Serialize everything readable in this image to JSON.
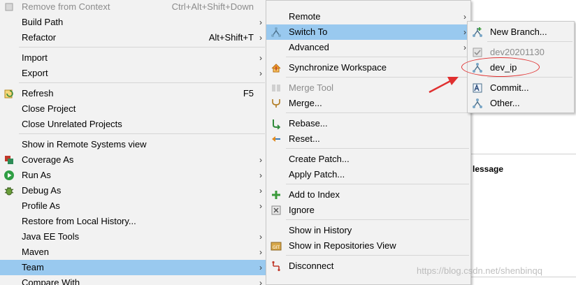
{
  "background": {
    "header": "lessage"
  },
  "context_menu": {
    "items": [
      {
        "label": "Remove from Context",
        "accel": "Ctrl+Alt+Shift+Down",
        "disabled": true,
        "icon": "remove-context-icon"
      },
      {
        "label": "Build Path",
        "submenu": true
      },
      {
        "label": "Refactor",
        "accel": "Alt+Shift+T",
        "submenu": true
      },
      {
        "label": "Import",
        "submenu": true
      },
      {
        "label": "Export",
        "submenu": true
      },
      {
        "label": "Refresh",
        "accel": "F5",
        "icon": "refresh-icon"
      },
      {
        "label": "Close Project"
      },
      {
        "label": "Close Unrelated Projects"
      },
      {
        "label": "Show in Remote Systems view"
      },
      {
        "label": "Coverage As",
        "submenu": true,
        "icon": "coverage-icon"
      },
      {
        "label": "Run As",
        "submenu": true,
        "icon": "run-icon"
      },
      {
        "label": "Debug As",
        "submenu": true,
        "icon": "debug-icon"
      },
      {
        "label": "Profile As",
        "submenu": true
      },
      {
        "label": "Restore from Local History..."
      },
      {
        "label": "Java EE Tools",
        "submenu": true
      },
      {
        "label": "Maven",
        "submenu": true
      },
      {
        "label": "Team",
        "submenu": true,
        "selected": true
      },
      {
        "label": "Compare With",
        "submenu": true
      }
    ]
  },
  "team_menu": {
    "items": [
      {
        "label": "Remote",
        "submenu": true
      },
      {
        "label": "Switch To",
        "submenu": true,
        "selected": true,
        "icon": "git-branch-icon"
      },
      {
        "label": "Advanced",
        "submenu": true
      },
      {
        "label": "Synchronize Workspace",
        "icon": "synchronize-icon"
      },
      {
        "label": "Merge Tool",
        "disabled": true,
        "icon": "merge-tool-icon"
      },
      {
        "label": "Merge...",
        "icon": "merge-icon"
      },
      {
        "label": "Rebase...",
        "icon": "rebase-icon"
      },
      {
        "label": "Reset...",
        "icon": "reset-icon"
      },
      {
        "label": "Create Patch..."
      },
      {
        "label": "Apply Patch..."
      },
      {
        "label": "Add to Index",
        "icon": "add-index-icon"
      },
      {
        "label": "Ignore",
        "icon": "ignore-icon"
      },
      {
        "label": "Show in History"
      },
      {
        "label": "Show in Repositories View",
        "icon": "git-repo-icon"
      },
      {
        "label": "Disconnect",
        "icon": "disconnect-icon"
      }
    ]
  },
  "switch_menu": {
    "items": [
      {
        "label": "New Branch...",
        "icon": "new-branch-icon"
      },
      {
        "label": "dev20201130",
        "disabled": true,
        "icon": "checked-branch-icon"
      },
      {
        "label": "dev_ip",
        "icon": "git-branch-icon"
      },
      {
        "label": "Commit...",
        "icon": "commit-icon"
      },
      {
        "label": "Other...",
        "icon": "git-branch-icon"
      }
    ]
  },
  "watermark": "https://blog.csdn.net/shenbinqq",
  "colors": {
    "menu_bg": "#f2f2f2",
    "selected_bg": "#99c9ef",
    "annotation": "#e03030",
    "disabled_text": "#8c8c8c"
  }
}
